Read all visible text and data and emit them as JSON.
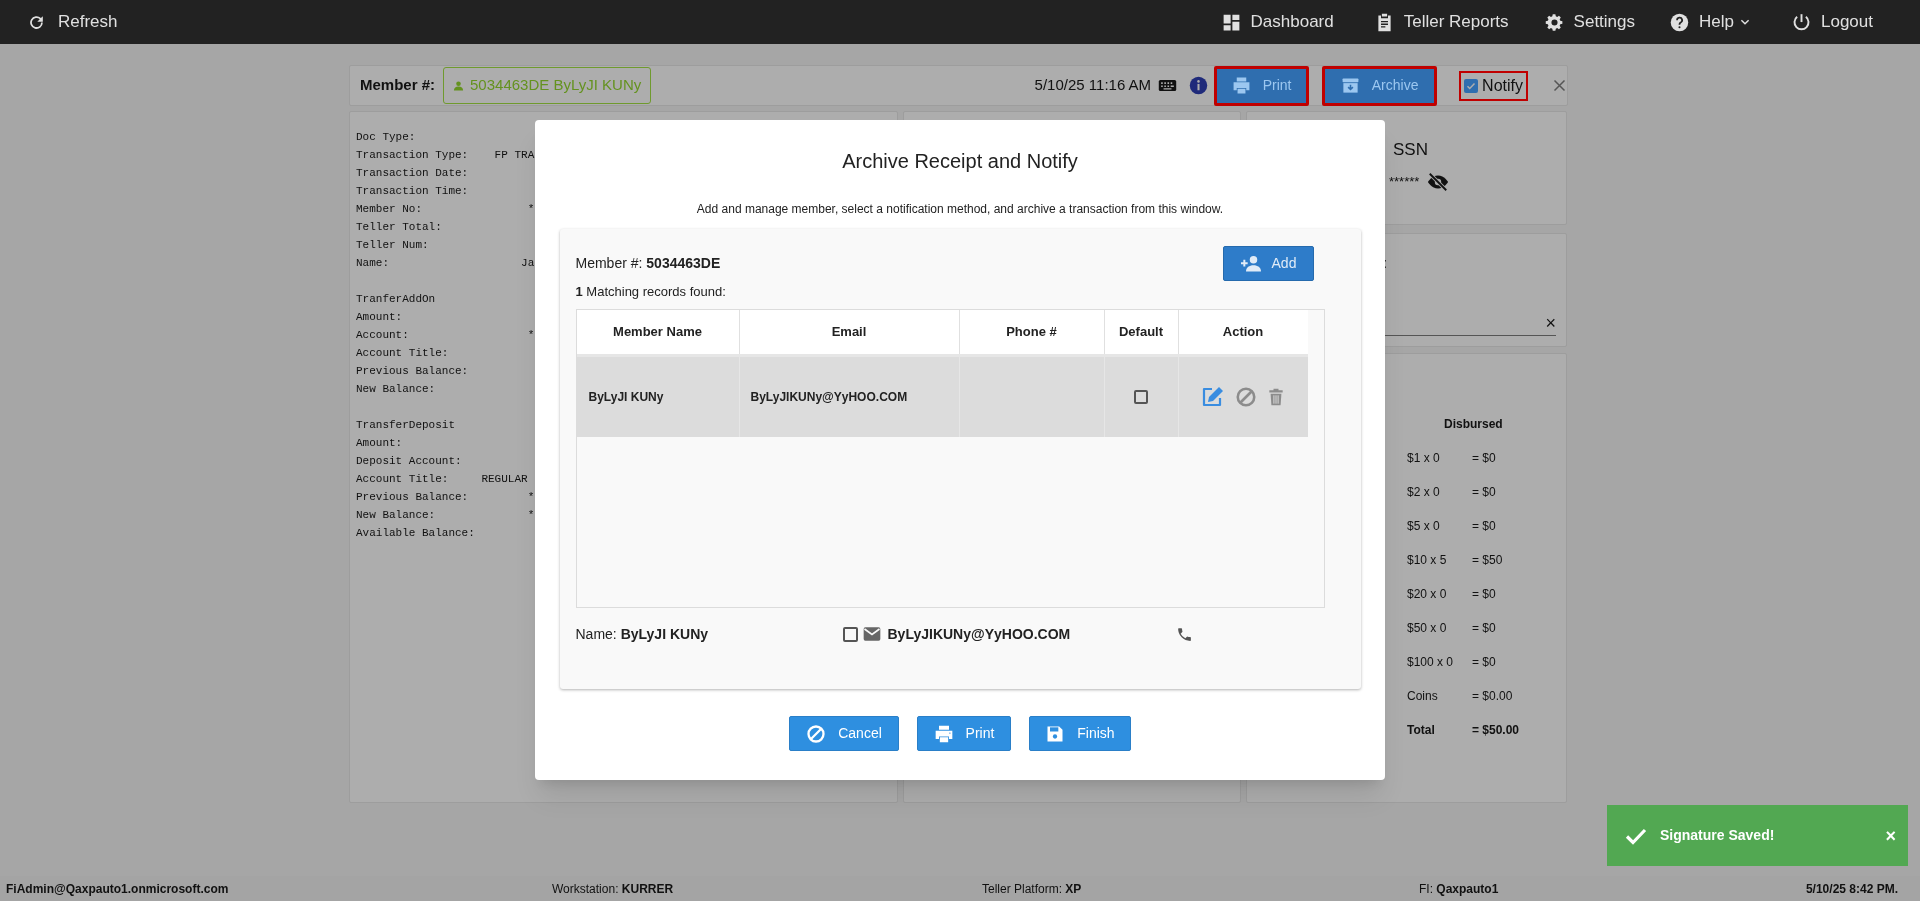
{
  "top_bar": {
    "left": [
      {
        "label": "Refresh"
      }
    ],
    "right": [
      {
        "label": "Dashboard",
        "has_menu": false
      },
      {
        "label": "Teller Reports",
        "has_menu": false
      },
      {
        "label": "Settings",
        "has_menu": false
      },
      {
        "label": "Help",
        "has_menu": true
      },
      {
        "label": "Logout",
        "has_menu": false
      }
    ]
  },
  "header": {
    "member_label": "Member #:",
    "member_chip": "5034463DE ByLyJI KUNy",
    "datetime": "5/10/25 11:16 AM",
    "print": {
      "label": "Print",
      "highlighted": true
    },
    "archive": {
      "label": "Archive",
      "highlighted": true
    },
    "notify": {
      "label": "Notify",
      "checked": true,
      "highlighted": true
    }
  },
  "receipt": {
    "sections": [
      [
        "Doc Type:",
        "Transaction Type:    FP TRA",
        "Transaction Date:",
        "Transaction Time:",
        "Member No:                *",
        "Teller Total:",
        "Teller Num:",
        "Name:                    Ja"
      ],
      [
        "TranferAddOn",
        "Amount:",
        "Account:                  *",
        "Account Title:",
        "Previous Balance:",
        "New Balance:"
      ],
      [
        "TransferDeposit",
        "Amount:",
        "Deposit Account:",
        "Account Title:     REGULAR",
        "Previous Balance:         *",
        "New Balance:              *",
        "Available Balance:"
      ]
    ]
  },
  "ssn_panel": {
    "title": "SSN",
    "masked": "******"
  },
  "search_panel": {
    "label": ":",
    "clear": "×"
  },
  "disbursed": {
    "heading": "Disbursed",
    "rows": [
      {
        "kind": "row",
        "denomination": "$1 x 0",
        "amount": "= $0"
      },
      {
        "kind": "row",
        "denomination": "$2 x 0",
        "amount": "= $0"
      },
      {
        "kind": "row",
        "denomination": "$5 x 0",
        "amount": "= $0"
      },
      {
        "kind": "row",
        "denomination": "$10 x 5",
        "amount": "= $50"
      },
      {
        "kind": "row",
        "denomination": "$20 x 0",
        "amount": "= $0"
      },
      {
        "kind": "row",
        "denomination": "$50 x 0",
        "amount": "= $0"
      },
      {
        "kind": "row",
        "denomination": "$100 x 0",
        "amount": "= $0"
      },
      {
        "kind": "row",
        "denomination": "Coins",
        "amount": "= $0.00"
      },
      {
        "kind": "total",
        "denomination": "Total",
        "amount": "= $50.00"
      }
    ]
  },
  "modal": {
    "title": "Archive Receipt and Notify",
    "subtitle": "Add and manage member, select a notification method, and archive a transaction from this window.",
    "member_line": "Member #: **5034463DE**",
    "add_button": "Add",
    "match_line": "**1** Matching records found:",
    "table": {
      "columns": [
        "Member Name",
        "Email",
        "Phone #",
        "Default",
        "Action"
      ],
      "rows": [
        {
          "member_name": "ByLyJI KUNy",
          "email": "ByLyJIKUNy@YyHOO.COM",
          "default": false,
          "selected": true
        }
      ]
    },
    "contact": {
      "name_line": "Name: **ByLyJI KUNy**",
      "email_checked": false,
      "email": "ByLyJIKUNy@YyHOO.COM"
    },
    "buttons": [
      "Cancel",
      "Print",
      "Finish"
    ]
  },
  "toast": {
    "message": "Signature Saved!",
    "close": "×"
  },
  "status_bar": [
    {
      "value": "FiAdmin@Qaxpauto1.onmicrosoft.com"
    },
    {
      "label": "Workstation:",
      "value": "KURRER"
    },
    {
      "label": "Teller Platform:",
      "value": "XP"
    },
    {
      "label": "FI:",
      "value": "Qaxpauto1"
    },
    {
      "value": "5/10/25 8:42 PM."
    }
  ]
}
